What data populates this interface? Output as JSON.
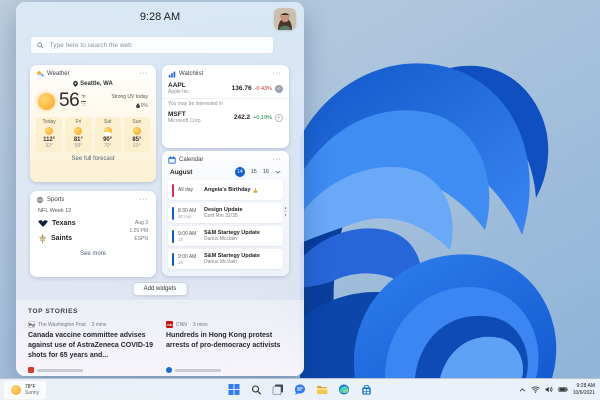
{
  "colors": {
    "accent_blue": "#0b5fce",
    "stock_down": "#c5352e",
    "stock_up": "#107c41",
    "event_pink": "#dd2667",
    "event_blue": "#1157d2",
    "cnn_red": "#cc0a0a"
  },
  "icons": {
    "more": "···"
  },
  "panel": {
    "time": "9:28 AM",
    "search_placeholder": "Type here to search the web",
    "add_widgets": "Add widgets"
  },
  "weather": {
    "title": "Weather",
    "location": "Seattle, WA",
    "temp": "56",
    "unit_f": "°F",
    "unit_c": "°C",
    "uv_note": "Strong UV today",
    "precip": "0%",
    "forecast": [
      {
        "day": "Today",
        "icon": "sunny",
        "high": "112°",
        "low": "92°"
      },
      {
        "day": "Fri",
        "icon": "sunny",
        "high": "81°",
        "low": "68°"
      },
      {
        "day": "Sat",
        "icon": "partly-cloudy",
        "high": "90°",
        "low": "70°"
      },
      {
        "day": "Sun",
        "icon": "sunny",
        "high": "85°",
        "low": "69°"
      }
    ],
    "link": "See full forecast"
  },
  "watchlist": {
    "title": "Watchlist",
    "stocks": [
      {
        "symbol": "AAPL",
        "company": "Apple Inc.",
        "price": "136.76",
        "change": "-0.43%",
        "direction": "down",
        "action": "added"
      },
      {
        "symbol": "MSFT",
        "company": "Microsoft Corp.",
        "price": "242.2",
        "change": "+0.19%",
        "direction": "up",
        "action": "add"
      }
    ],
    "suggestion": "You may be interested in"
  },
  "calendar": {
    "title": "Calendar",
    "month": "August",
    "dates": [
      "14",
      "15",
      "16"
    ],
    "selected_date": "14",
    "events": [
      {
        "time": "All day",
        "duration": "",
        "title": "Angela's Birthday",
        "subtitle": "",
        "color": "pink"
      },
      {
        "time": "8:30 AM",
        "duration": "30 min",
        "title": "Design Update",
        "subtitle": "Conf Rm 32/35",
        "color": "blue"
      },
      {
        "time": "9:00 AM",
        "duration": "1h",
        "title": "S&M Startegy Update",
        "subtitle": "Darius Mcclain",
        "color": "blue"
      },
      {
        "time": "9:00 AM",
        "duration": "1h",
        "title": "S&M Startegy Update",
        "subtitle": "Darius Mcclain",
        "color": "blue"
      }
    ]
  },
  "sports": {
    "title": "Sports",
    "league": "NFL Week 12",
    "teams": [
      {
        "name": "Texans"
      },
      {
        "name": "Saints"
      }
    ],
    "date": "Aug 3",
    "time": "1:25 PM",
    "network": "ESPN",
    "link": "See more"
  },
  "top_stories": {
    "title": "TOP STORIES",
    "items": [
      {
        "source": "The Washington Post",
        "age": "· 3 mins",
        "icon_text": "Wp",
        "headline": "Canada vaccine committee advises against use of AstraZeneca COVID-19 shots for 65 years and..."
      },
      {
        "source": "CNN",
        "age": "· 3 mins",
        "icon_text": "CNN",
        "headline": "Hundreds in Hong Kong protest arrests of pro-democracy activists"
      }
    ]
  },
  "taskbar": {
    "weather_temp": "78°F",
    "weather_cond": "Sunny",
    "time": "9:28 AM",
    "date": "10/6/2021"
  }
}
